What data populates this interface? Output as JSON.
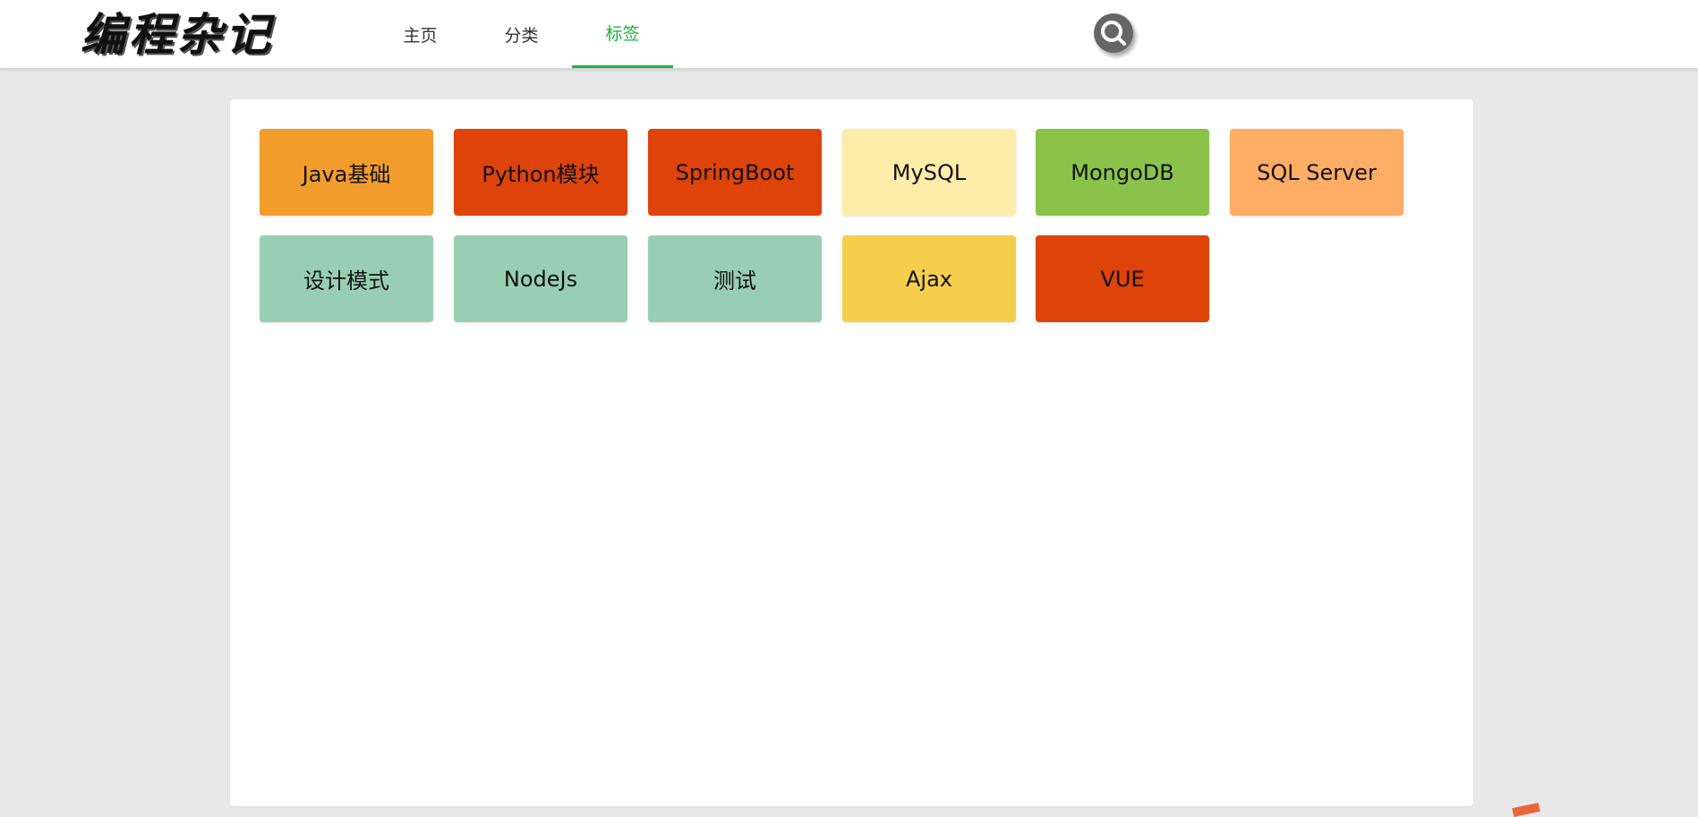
{
  "header": {
    "logo_text": "编程杂记",
    "nav": [
      {
        "label": "主页",
        "active": false
      },
      {
        "label": "分类",
        "active": false
      },
      {
        "label": "标签",
        "active": true
      }
    ],
    "search_icon": "search-icon"
  },
  "colors": {
    "accent": "#1fb33a",
    "page_bg": "#e8e8e8",
    "panel_bg": "#ffffff"
  },
  "tags": [
    {
      "label": "Java基础",
      "color": "#f29c2c"
    },
    {
      "label": "Python模块",
      "color": "#de4309"
    },
    {
      "label": "SpringBoot",
      "color": "#de4309"
    },
    {
      "label": "MySQL",
      "color": "#feeda9"
    },
    {
      "label": "MongoDB",
      "color": "#8bc34a"
    },
    {
      "label": "SQL Server",
      "color": "#ffad65"
    },
    {
      "label": "设计模式",
      "color": "#98cfb2"
    },
    {
      "label": "NodeJs",
      "color": "#98cfb2"
    },
    {
      "label": "测试",
      "color": "#98cfb2"
    },
    {
      "label": "Ajax",
      "color": "#f5ce4b"
    },
    {
      "label": "VUE",
      "color": "#de4309"
    }
  ]
}
